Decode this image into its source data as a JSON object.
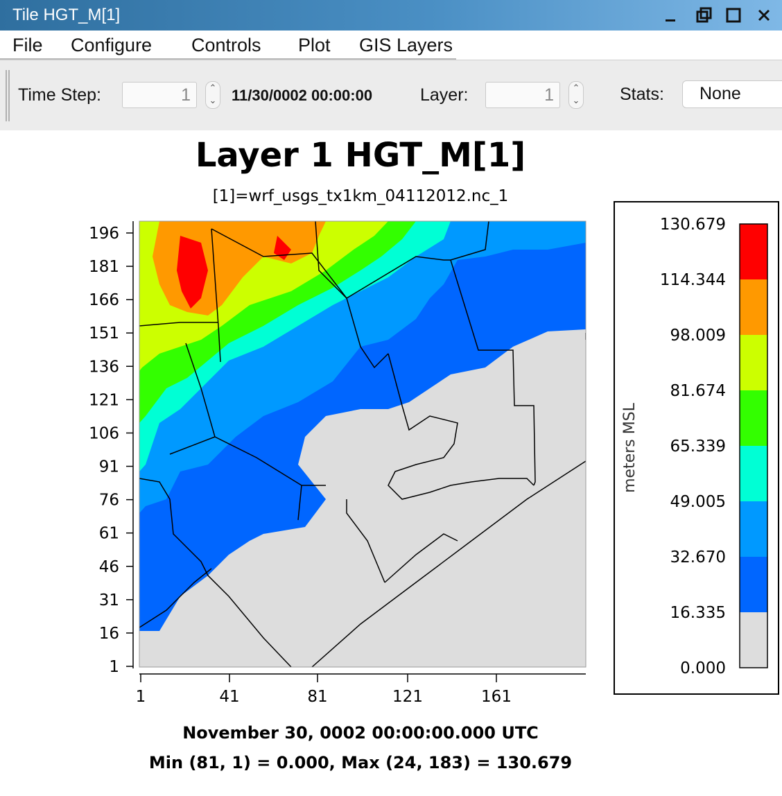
{
  "window": {
    "title": "Tile HGT_M[1]"
  },
  "menu": [
    "File",
    "Configure",
    "Controls",
    "Plot",
    "GIS Layers"
  ],
  "toolbar": {
    "time_step_label": "Time Step:",
    "time_step_value": "1",
    "datetime": "11/30/0002 00:00:00",
    "layer_label": "Layer:",
    "layer_value": "1",
    "stats_label": "Stats:",
    "stats_value": "None"
  },
  "plot": {
    "title": "Layer 1 HGT_M[1]",
    "subtitle": "[1]=wrf_usgs_tx1km_04112012.nc_1",
    "footer_time": "November 30, 0002 00:00:00.000 UTC",
    "footer_stats": "Min (81, 1) = 0.000, Max (24, 183) = 130.679"
  },
  "chart_data": {
    "type": "heatmap",
    "title": "Layer 1 HGT_M[1]",
    "subtitle": "[1]=wrf_usgs_tx1km_04112012.nc_1",
    "x_ticks": [
      "1",
      "41",
      "81",
      "121",
      "161"
    ],
    "y_ticks": [
      "196",
      "181",
      "166",
      "151",
      "136",
      "121",
      "106",
      "91",
      "76",
      "61",
      "46",
      "31",
      "16",
      "1"
    ],
    "xlim": [
      1,
      201
    ],
    "ylim": [
      1,
      201
    ],
    "colorbar": {
      "label": "meters MSL",
      "ticks": [
        "130.679",
        "114.344",
        "98.009",
        "81.674",
        "65.339",
        "49.005",
        "32.670",
        "16.335",
        "0.000"
      ],
      "colors": [
        "#ff0000",
        "#ff9900",
        "#ccff00",
        "#33ff00",
        "#00ffd5",
        "#0099ff",
        "#0066ff",
        "#dddddd"
      ]
    },
    "min": {
      "x": 81,
      "y": 1,
      "value": 0.0
    },
    "max": {
      "x": 24,
      "y": 183,
      "value": 130.679
    }
  },
  "colors": {
    "titlebar": "#3b82b8",
    "toolbar_bg": "#ececec",
    "land_bg": "#dddddd"
  }
}
